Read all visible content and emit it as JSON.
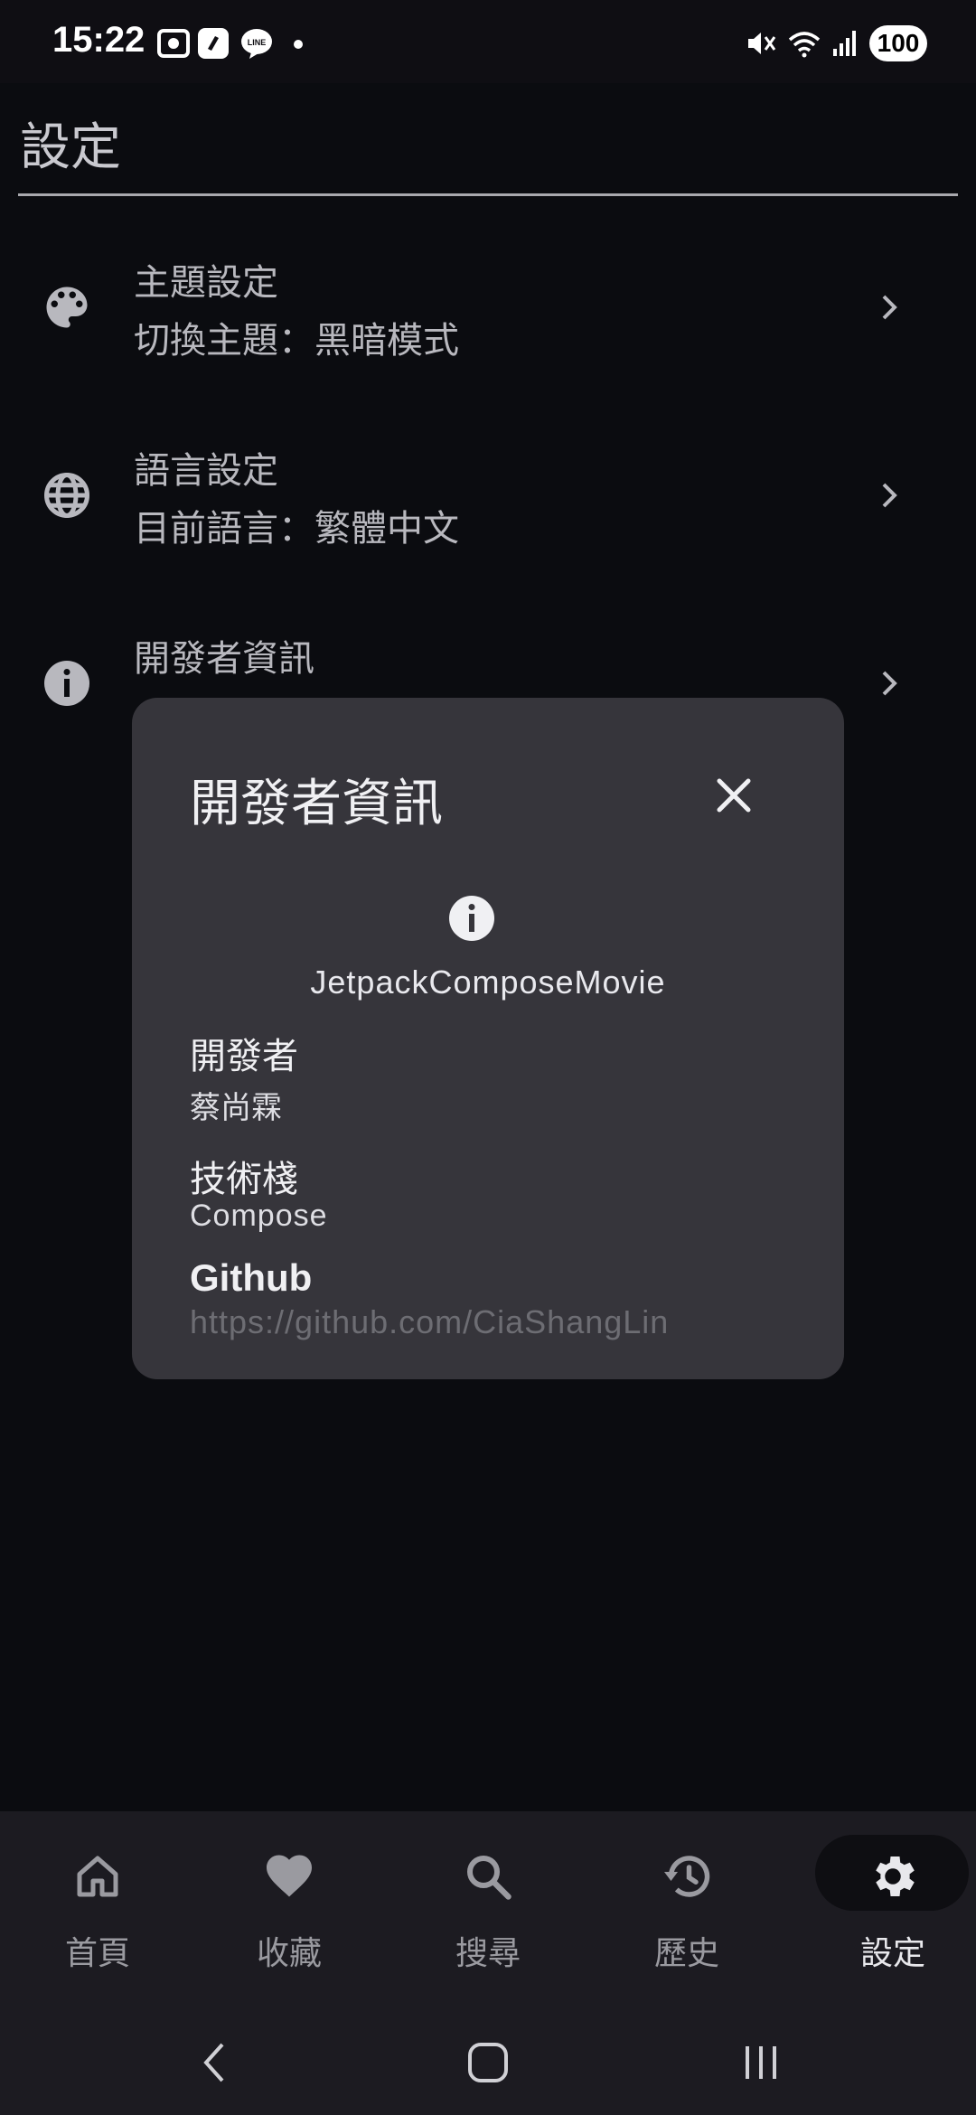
{
  "status_bar": {
    "time": "15:22",
    "battery": "100",
    "icons": [
      "screenshot-icon",
      "app-icon",
      "line-icon",
      "mute-icon",
      "wifi-icon",
      "signal-icon"
    ]
  },
  "page": {
    "title": "設定"
  },
  "settings": [
    {
      "icon": "palette-icon",
      "title": "主題設定",
      "subtitle": "切換主題：黑暗模式"
    },
    {
      "icon": "globe-icon",
      "title": "語言設定",
      "subtitle": "目前語言：繁體中文"
    },
    {
      "icon": "info-icon",
      "title": "開發者資訊",
      "subtitle": ""
    }
  ],
  "dialog": {
    "title": "開發者資訊",
    "app_name": "JetpackComposeMovie",
    "developer_label": "開發者",
    "developer_value": "蔡尚霖",
    "stack_label": "技術棧",
    "stack_value": "Compose",
    "github_label": "Github",
    "github_url": "https://github.com/CiaShangLin"
  },
  "bottom_nav": [
    {
      "icon": "home-icon",
      "label": "首頁",
      "active": false
    },
    {
      "icon": "heart-icon",
      "label": "收藏",
      "active": false
    },
    {
      "icon": "search-icon",
      "label": "搜尋",
      "active": false
    },
    {
      "icon": "history-icon",
      "label": "歷史",
      "active": false
    },
    {
      "icon": "gear-icon",
      "label": "設定",
      "active": true
    }
  ],
  "colors": {
    "background": "#0b0c10",
    "dialog": "#36353b",
    "nav_bar": "#1c1b21"
  }
}
